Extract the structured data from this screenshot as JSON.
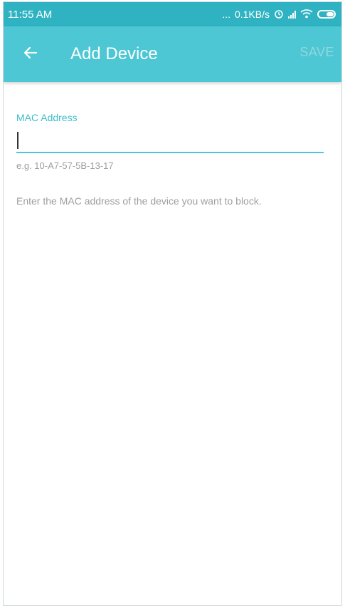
{
  "status_bar": {
    "time": "11:55 AM",
    "dots": "...",
    "network_speed": "0.1KB/s",
    "icons": [
      "alarm-icon",
      "signal-icon",
      "wifi-icon",
      "battery-icon"
    ]
  },
  "app_bar": {
    "back_icon": "arrow-left-icon",
    "title": "Add Device",
    "save_label": "SAVE"
  },
  "form": {
    "mac_label": "MAC Address",
    "mac_value": "",
    "mac_example": "e.g. 10-A7-57-5B-13-17",
    "helper_text": "Enter the MAC address of the device you want to block."
  },
  "colors": {
    "status_bar": "#2fb3c2",
    "app_bar": "#4cc7d3",
    "accent": "#3cbcc9",
    "save_disabled": "#93d6df",
    "hint_text": "#9e9e9e"
  }
}
